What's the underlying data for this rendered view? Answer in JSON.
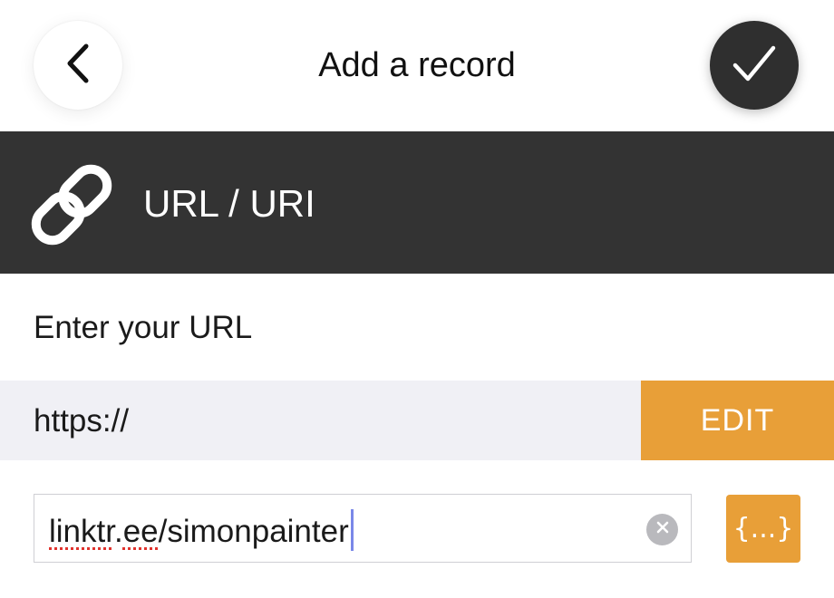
{
  "header": {
    "title": "Add a record",
    "back_icon": "chevron-left-icon",
    "confirm_icon": "checkmark-icon"
  },
  "record_type": {
    "label": "URL / URI",
    "icon": "link-icon"
  },
  "form": {
    "prompt": "Enter your URL",
    "scheme": {
      "value": "https://",
      "edit_label": "EDIT"
    },
    "url_input": {
      "value_spell_part1": "linktr",
      "value_mid": ".",
      "value_spell_part2": "ee",
      "value_rest": "/simonpainter",
      "clear_icon": "clear-icon"
    },
    "variables_button_label": "{...}"
  },
  "colors": {
    "accent": "#E89F38",
    "banner": "#333333",
    "scheme_row": "#F0F0F5",
    "confirm_button": "#2F2F2F"
  }
}
